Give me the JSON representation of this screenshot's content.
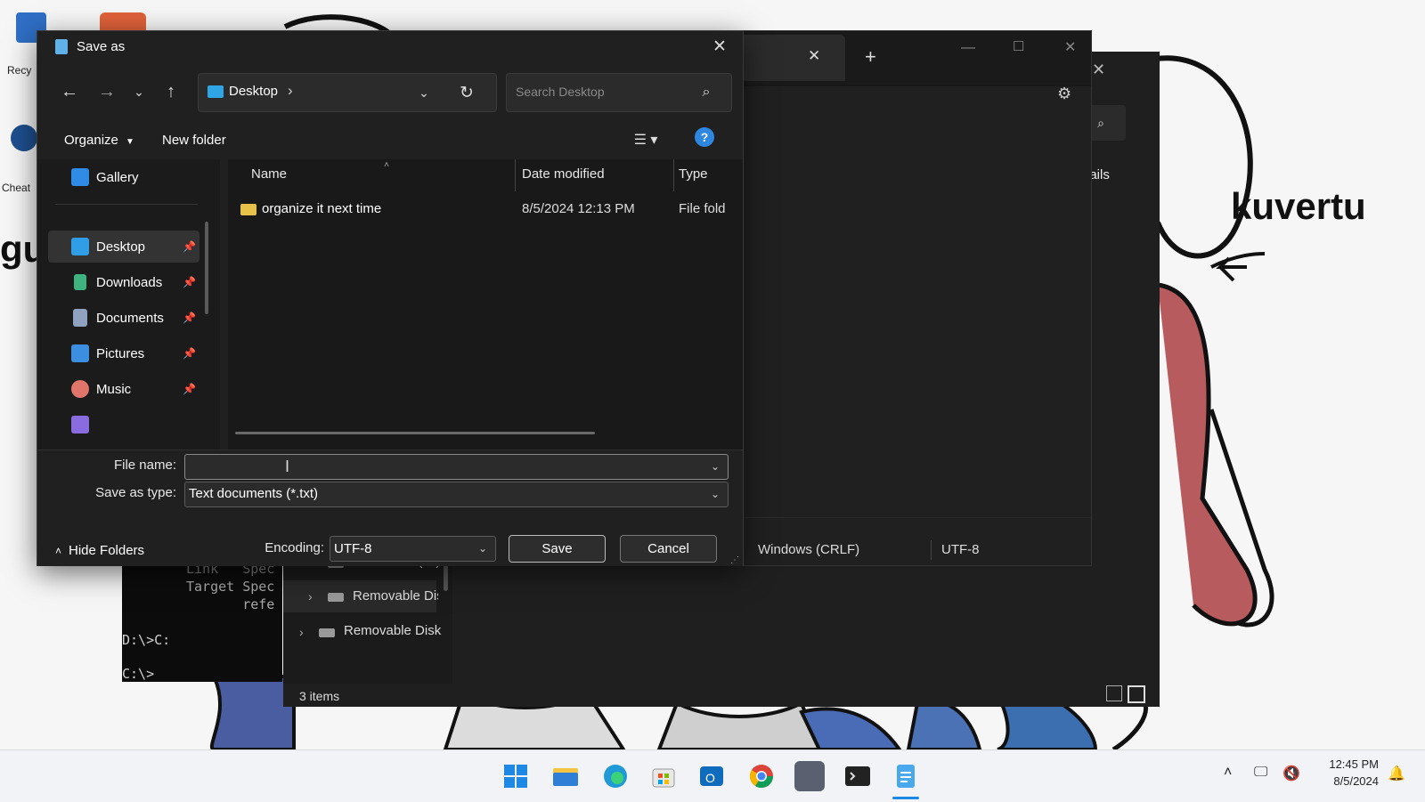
{
  "desktop": {
    "icon_labels": [
      "Recy",
      "Cheat"
    ],
    "left_text": "gu",
    "right_text": "kuvertu"
  },
  "explorer_bg": {
    "details_label": "Details",
    "status_items": "3 items",
    "tree_items": [
      "Local Disk (C:)",
      "Removable Dis",
      "Removable Disk"
    ]
  },
  "terminal_bg": {
    "lines": [
      "Link   Spec",
      "Target Spec",
      "       refe",
      "D:\\>C:",
      "C:\\>"
    ]
  },
  "notepad_bg": {
    "line_ending": "Windows (CRLF)",
    "encoding": "UTF-8"
  },
  "dialog": {
    "title": "Save as",
    "address": {
      "location": "Desktop",
      "separator": "›"
    },
    "search": {
      "placeholder": "Search Desktop"
    },
    "toolbar": {
      "organize": "Organize",
      "new_folder": "New folder"
    },
    "nav": {
      "items": [
        {
          "label": "Gallery",
          "icon": "gallery-icon",
          "color": "#2f8be6"
        },
        {
          "label": "Desktop",
          "icon": "desktop-icon",
          "color": "#2f9ee6",
          "selected": true,
          "pinned": true
        },
        {
          "label": "Downloads",
          "icon": "download-icon",
          "color": "#3fb37f",
          "pinned": true
        },
        {
          "label": "Documents",
          "icon": "document-icon",
          "color": "#8fa2bf",
          "pinned": true
        },
        {
          "label": "Pictures",
          "icon": "picture-icon",
          "color": "#3c8fe0",
          "pinned": true
        },
        {
          "label": "Music",
          "icon": "music-icon",
          "color": "#e0766b",
          "pinned": true
        }
      ]
    },
    "columns": [
      "Name",
      "Date modified",
      "Type"
    ],
    "files": [
      {
        "name": "organize it next time",
        "date": "8/5/2024 12:13 PM",
        "type": "File fold"
      }
    ],
    "form": {
      "file_name_label": "File name:",
      "file_name_value": "",
      "save_type_label": "Save as type:",
      "save_type_value": "Text documents (*.txt)",
      "encoding_label": "Encoding:",
      "encoding_value": "UTF-8",
      "save": "Save",
      "cancel": "Cancel",
      "hide_folders": "Hide Folders"
    }
  },
  "taskbar": {
    "apps": [
      "start-icon",
      "file-explorer-icon",
      "edge-icon",
      "store-icon",
      "outlook-icon",
      "chrome-icon",
      "game-icon",
      "terminal-icon",
      "notepad-icon"
    ],
    "time": "12:45 PM",
    "date": "8/5/2024"
  }
}
